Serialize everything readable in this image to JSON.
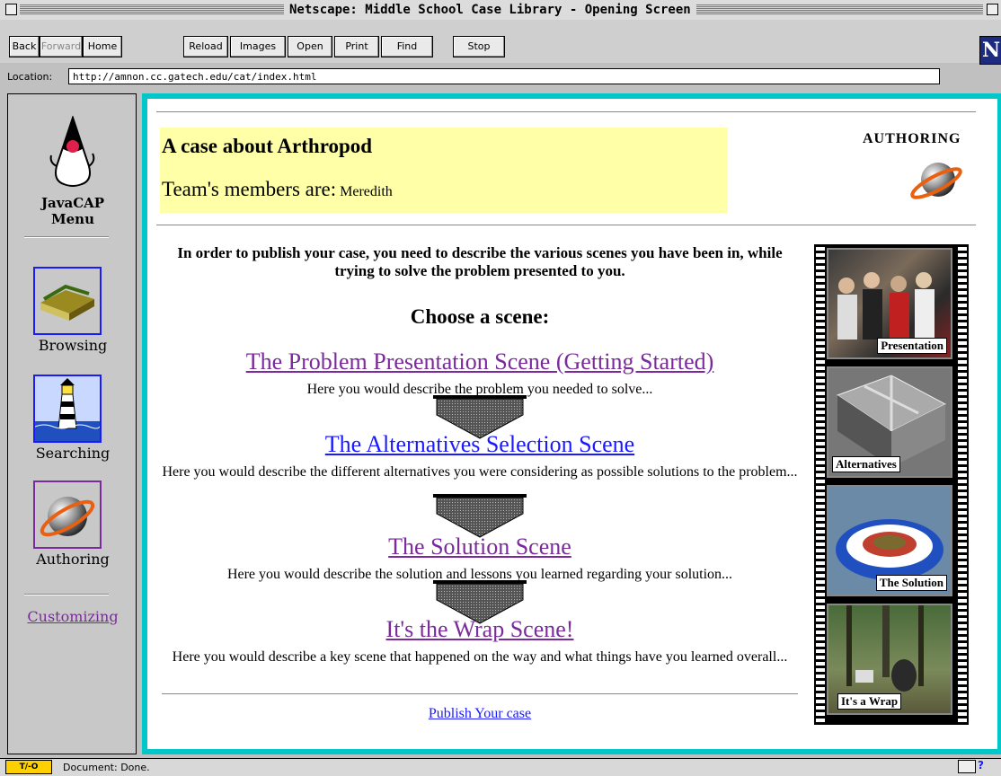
{
  "window": {
    "title": "Netscape: Middle School Case Library - Opening Screen"
  },
  "toolbar": {
    "buttons": [
      "Back",
      "Forward",
      "Home",
      "Reload",
      "Images",
      "Open",
      "Print",
      "Find",
      "Stop"
    ],
    "logo": "N"
  },
  "location": {
    "label": "Location:",
    "url": "http://amnon.cc.gatech.edu/cat/index.html"
  },
  "sidebar": {
    "menu_title_1": "JavaCAP",
    "menu_title_2": "Menu",
    "items": [
      {
        "label": "Browsing",
        "icon": "book-icon"
      },
      {
        "label": "Searching",
        "icon": "lighthouse-icon"
      },
      {
        "label": "Authoring",
        "icon": "globe-icon"
      }
    ],
    "customizing": "Customizing"
  },
  "main": {
    "case_title": "A case about Arthropod",
    "team_label": "Team's members are:",
    "team_members": "Meredith",
    "mode_label": "AUTHORING",
    "intro": "In order to publish your case, you need to describe the various scenes you have been in, while trying to solve the problem presented to you.",
    "choose_heading": "Choose a scene:",
    "scenes": [
      {
        "title": "The Problem Presentation Scene (Getting Started)",
        "desc": "Here you would describe the problem you needed to solve..."
      },
      {
        "title": "The Alternatives Selection Scene",
        "desc": "Here you would describe the different alternatives you were considering as possible solutions to the problem..."
      },
      {
        "title": "The Solution Scene",
        "desc": "Here you would describe the solution and lessons you learned regarding your solution..."
      },
      {
        "title": "It's the Wrap Scene!",
        "desc": "Here you would describe a key scene that happened on the way and what things have you learned overall..."
      }
    ],
    "publish_link": "Publish Your case",
    "film_frames": [
      "Presentation",
      "Alternatives",
      "The Solution",
      "It's a Wrap"
    ]
  },
  "status": {
    "text": "Document: Done."
  },
  "colors": {
    "visited_link": "#7b2a9b",
    "link": "#1a1aff",
    "case_box": "#ffffa8",
    "frame_border": "#00c8c8"
  }
}
